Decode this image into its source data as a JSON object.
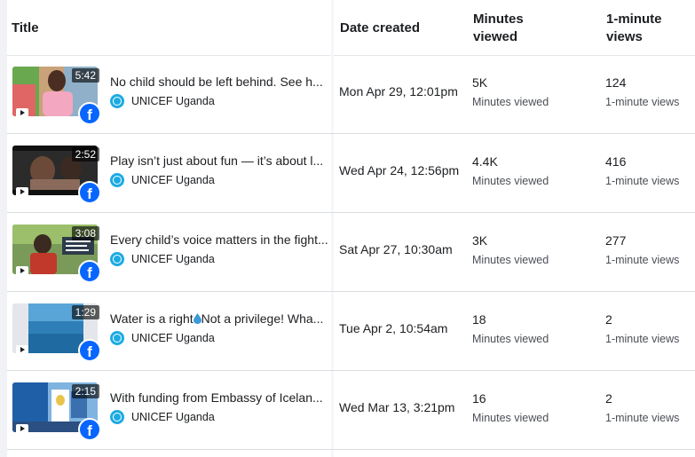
{
  "header": {
    "title": "Title",
    "date_created": "Date created",
    "minutes_viewed": "Minutes viewed",
    "one_minute_views": "1-minute views"
  },
  "page_name": "UNICEF Uganda",
  "minutes_viewed_label": "Minutes viewed",
  "one_minute_views_label": "1-minute views",
  "rows": [
    {
      "duration": "5:42",
      "title": "No child should be left behind. See h...",
      "page": "UNICEF Uganda",
      "date": "Mon Apr 29, 12:01pm",
      "minutes": "5K",
      "views": "124",
      "thumb_colors": [
        "#6aa84f",
        "#e06666",
        "#f4a7c0"
      ]
    },
    {
      "duration": "2:52",
      "title": "Play isn’t just about fun — it’s about l...",
      "page": "UNICEF Uganda",
      "date": "Wed Apr 24, 12:56pm",
      "minutes": "4.4K",
      "views": "416",
      "thumb_colors": [
        "#111111",
        "#6b4a3a",
        "#3a3a3a"
      ]
    },
    {
      "duration": "3:08",
      "title": "Every child’s voice matters in the fight...",
      "page": "UNICEF Uganda",
      "date": "Sat Apr 27, 10:30am",
      "minutes": "3K",
      "views": "277",
      "thumb_colors": [
        "#5d8a3c",
        "#c0392b",
        "#2d3b4a"
      ]
    },
    {
      "duration": "1:29",
      "title_before": "Water is a right",
      "title_after": "Not a privilege! Wha...",
      "page": "UNICEF Uganda",
      "date": "Tue Apr 2, 10:54am",
      "minutes": "18",
      "views": "2",
      "thumb_colors": [
        "#2e7fb8",
        "#5aa5d8",
        "#1f6aa0"
      ]
    },
    {
      "duration": "2:15",
      "title": "With funding from Embassy of Icelan...",
      "page": "UNICEF Uganda",
      "date": "Wed Mar 13, 3:21pm",
      "minutes": "16",
      "views": "2",
      "thumb_colors": [
        "#1f5fa8",
        "#7fb3e0",
        "#e8c44a"
      ]
    }
  ],
  "colors": {
    "facebook_blue": "#0866ff",
    "unicef_blue": "#1cabe2"
  },
  "icons": [
    "play-icon",
    "facebook-icon",
    "unicef-page-icon",
    "water-drop-icon"
  ]
}
